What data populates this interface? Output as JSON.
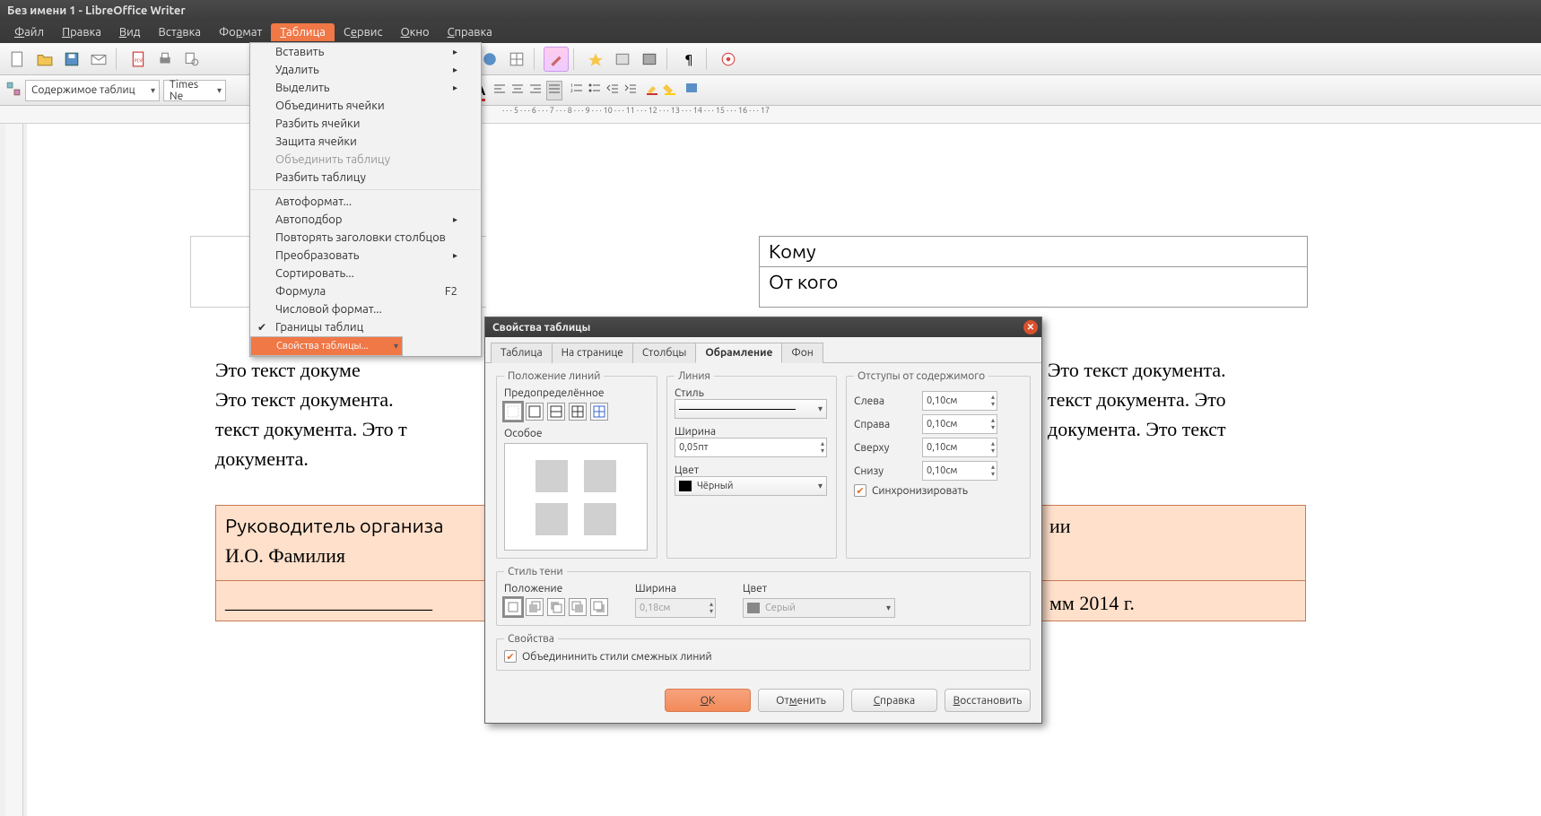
{
  "title": "Без имени 1 - LibreOffice Writer",
  "menu": {
    "items": [
      "Файл",
      "Правка",
      "Вид",
      "Вставка",
      "Формат",
      "Таблица",
      "Сервис",
      "Окно",
      "Справка"
    ],
    "open_index": 5
  },
  "dropdown": {
    "items": [
      {
        "label": "Вставить",
        "sub": true
      },
      {
        "label": "Удалить",
        "sub": true
      },
      {
        "label": "Выделить",
        "sub": true
      },
      {
        "label": "Объединить ячейки"
      },
      {
        "label": "Разбить ячейки"
      },
      {
        "label": "Защита ячейки"
      },
      {
        "label": "Объединить таблицу",
        "disabled": true
      },
      {
        "label": "Разбить таблицу"
      },
      {
        "divider": true
      },
      {
        "label": "Автоформат..."
      },
      {
        "label": "Автоподбор",
        "sub": true
      },
      {
        "label": "Повторять заголовки столбцов"
      },
      {
        "label": "Преобразовать",
        "sub": true
      },
      {
        "label": "Сортировать..."
      },
      {
        "label": "Формула",
        "accel": "F2"
      },
      {
        "label": "Числовой формат..."
      },
      {
        "label": "Границы таблиц",
        "check": true
      },
      {
        "label": "Свойства таблицы...",
        "selected": true
      }
    ]
  },
  "toolbar2": {
    "style_combo": "Содержимое таблиц",
    "font_combo": "Times Ne"
  },
  "doc": {
    "table1": {
      "r1": "Кому",
      "r2": "От кого"
    },
    "para": "Это текст документа. Это текст документа. Это текст документа. Это текст документа. Это текст документа. Это текст документа. Это текст документа. Это текст документа.",
    "table2": {
      "l1": "Руководитель организа",
      "l2": "И.О. Фамилия",
      "l3": "_____________________",
      "c3": "«.....",
      "r1": "ии",
      "r3": "мм  2014 г."
    }
  },
  "dialog": {
    "title": "Свойства таблицы",
    "tabs": [
      "Таблица",
      "На странице",
      "Столбцы",
      "Обрамление",
      "Фон"
    ],
    "active_tab": 3,
    "groups": {
      "lines": "Положение линий",
      "predefined": "Предопределённое",
      "custom": "Особое",
      "line": "Линия",
      "style": "Стиль",
      "width": "Ширина",
      "width_val": "0,05пт",
      "color": "Цвет",
      "color_val": "Чёрный",
      "margins": "Отступы от содержимого",
      "left": "Слева",
      "left_val": "0,10см",
      "right": "Справа",
      "right_val": "0,10см",
      "top": "Сверху",
      "top_val": "0,10см",
      "bottom": "Снизу",
      "bottom_val": "0,10см",
      "sync": "Синхронизировать",
      "shadow": "Стиль тени",
      "position": "Положение",
      "sh_width": "Ширина",
      "sh_width_val": "0,18см",
      "sh_color": "Цвет",
      "sh_color_val": "Серый",
      "props": "Свойства",
      "merge": "Объедининить стили смежных линий"
    },
    "buttons": {
      "ok": "ОК",
      "cancel": "Отменить",
      "help": "Справка",
      "restore": "Восстановить"
    }
  }
}
